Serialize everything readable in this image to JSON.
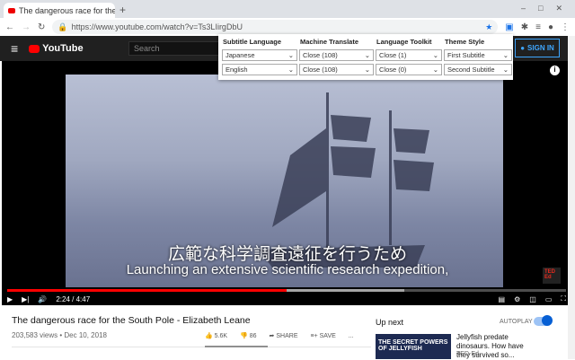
{
  "browser": {
    "tab_title": "The dangerous race for the So",
    "url": "https://www.youtube.com/watch?v=Ts3LIirgDbU"
  },
  "youtube": {
    "logo": "YouTube",
    "search_placeholder": "Search",
    "sign_in": "SIGN IN"
  },
  "popup": {
    "headers": [
      "Subtitle Language",
      "Machine Translate",
      "Language Toolkit",
      "Theme Style"
    ],
    "row1": [
      "Japanese",
      "Close (108)",
      "Close (1)",
      "First Subtitle"
    ],
    "row2": [
      "English",
      "Close (108)",
      "Close (0)",
      "Second Subtitle"
    ]
  },
  "player": {
    "subtitle_ja": "広範な科学調査遠征を行うため",
    "subtitle_en": "Launching an extensive scientific  research expedition,",
    "time": "2:24 / 4:47",
    "progress_percent": 50,
    "buffered_percent": 71,
    "badge": "TED Ed"
  },
  "video": {
    "title": "The dangerous race for the South Pole - Elizabeth Leane",
    "meta": "203,583 views • Dec 10, 2018",
    "likes": "5.6K",
    "dislikes": "86",
    "share": "SHARE",
    "save": "SAVE",
    "more": "..."
  },
  "sidebar": {
    "up_next": "Up next",
    "autoplay": "AUTOPLAY",
    "autoplay_on": true,
    "rec_title": "Jellyfish predate dinosaurs. How have they survived so...",
    "rec_channel": "TED-Ed",
    "thumb_text": "THE SECRET POWERS OF JELLYFISH"
  }
}
